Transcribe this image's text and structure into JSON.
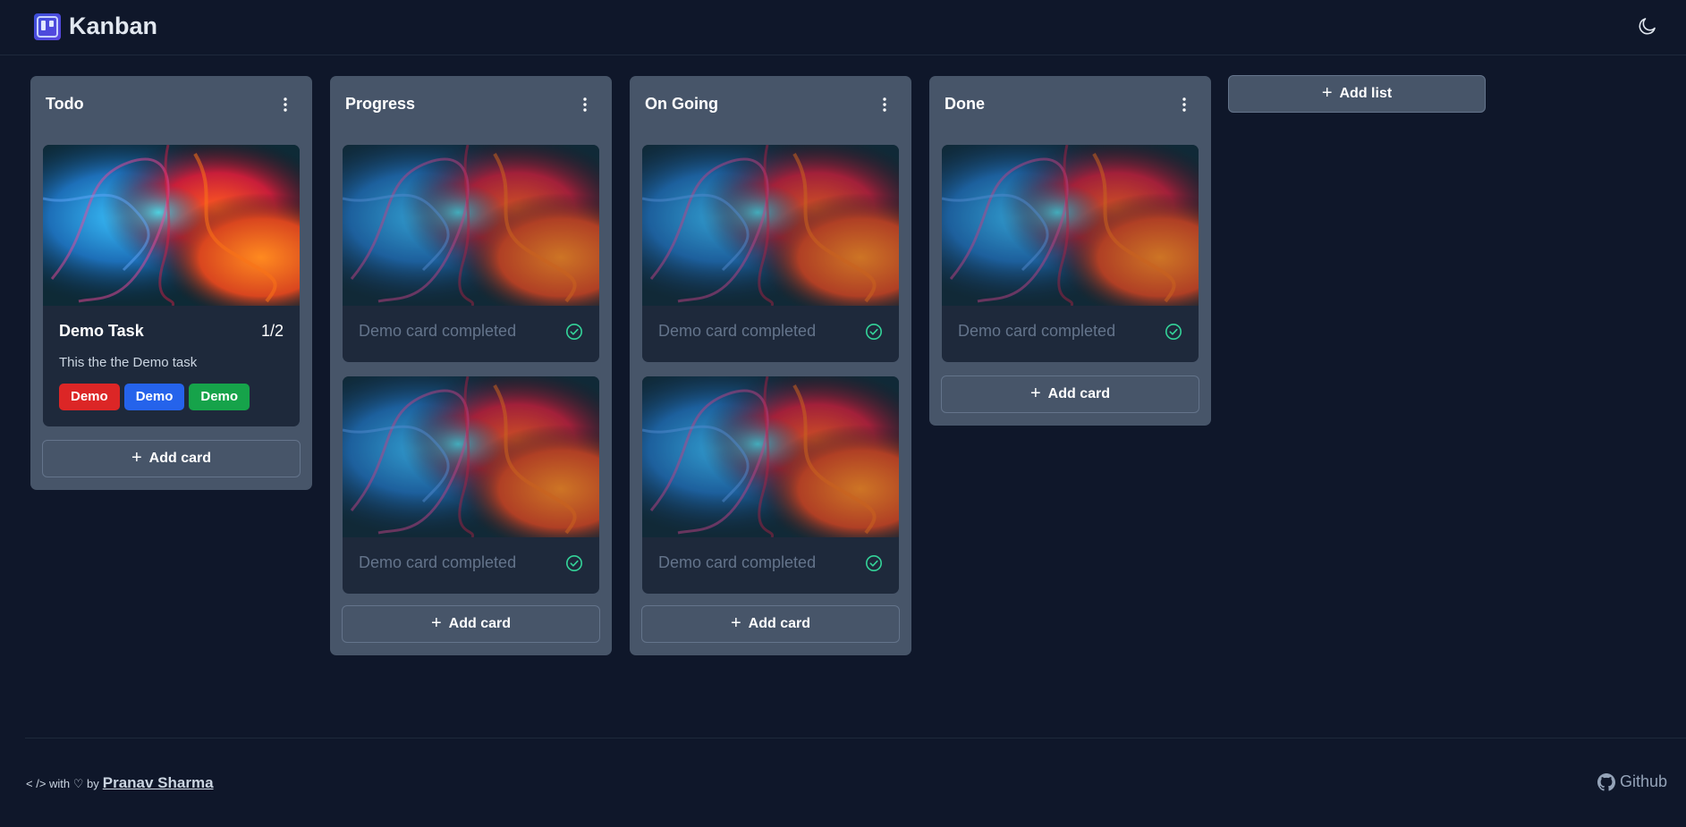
{
  "header": {
    "app_title": "Kanban",
    "logo_icon": "kanban-board-icon",
    "theme_icon": "moon-icon"
  },
  "lists": [
    {
      "title": "Todo",
      "cards": [
        {
          "title": "Demo Task",
          "count": "1/2",
          "description": "This the the Demo task",
          "tags": [
            {
              "label": "Demo",
              "color": "#dc2626"
            },
            {
              "label": "Demo",
              "color": "#2563eb"
            },
            {
              "label": "Demo",
              "color": "#16a34a"
            }
          ]
        }
      ],
      "add_card_label": "Add card"
    },
    {
      "title": "Progress",
      "cards": [
        {
          "title": "Demo card completed",
          "completed": true
        },
        {
          "title": "Demo card completed",
          "completed": true
        }
      ],
      "add_card_label": "Add card"
    },
    {
      "title": "On Going",
      "cards": [
        {
          "title": "Demo card completed",
          "completed": true
        },
        {
          "title": "Demo card completed",
          "completed": true
        }
      ],
      "add_card_label": "Add card"
    },
    {
      "title": "Done",
      "cards": [
        {
          "title": "Demo card completed",
          "completed": true
        }
      ],
      "add_card_label": "Add card"
    }
  ],
  "add_list_label": "Add list",
  "footer": {
    "made_with_prefix": "< /> with ♡ by",
    "author": "Pranav Sharma",
    "github_label": "Github"
  },
  "colors": {
    "background": "#0f172a",
    "list_bg": "#475569",
    "card_bg": "#1e293b",
    "check": "#34d399"
  }
}
